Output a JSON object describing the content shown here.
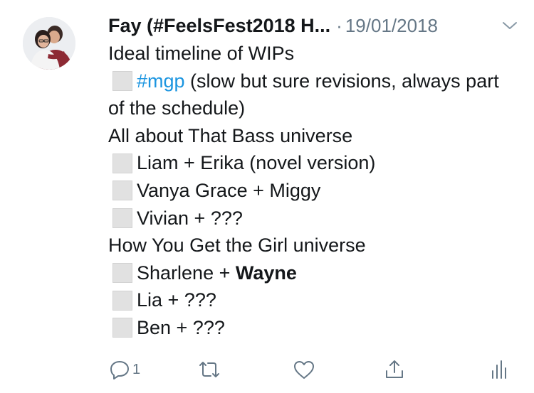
{
  "tweet": {
    "author": "Fay (#FeelsFest2018 H...",
    "date_separator": "·",
    "date": "19/01/2018"
  },
  "lines": [
    {
      "text": "Ideal timeline of WIPs"
    },
    {
      "hashtag": "#mgp",
      "text": " (slow but sure revisions, always part of the schedule)"
    },
    {
      "text": "All about That Bass universe"
    },
    {
      "text": "Liam + Erika (novel version)"
    },
    {
      "text": "Vanya Grace + Miggy"
    },
    {
      "text": "Vivian + ???"
    },
    {
      "text": "How You Get the Girl universe"
    },
    {
      "text": "Sharlene + ",
      "bold": "Wayne"
    },
    {
      "text": "Lia + ???"
    },
    {
      "text": "Ben + ???"
    }
  ],
  "actions": {
    "reply_count": "1",
    "icons": [
      "reply-icon",
      "retweet-icon",
      "like-icon",
      "share-icon",
      "analytics-icon"
    ]
  },
  "colors": {
    "text": "#14171a",
    "secondary": "#657786",
    "link": "#1b95e0",
    "checkbox": "#e1e1e1"
  }
}
